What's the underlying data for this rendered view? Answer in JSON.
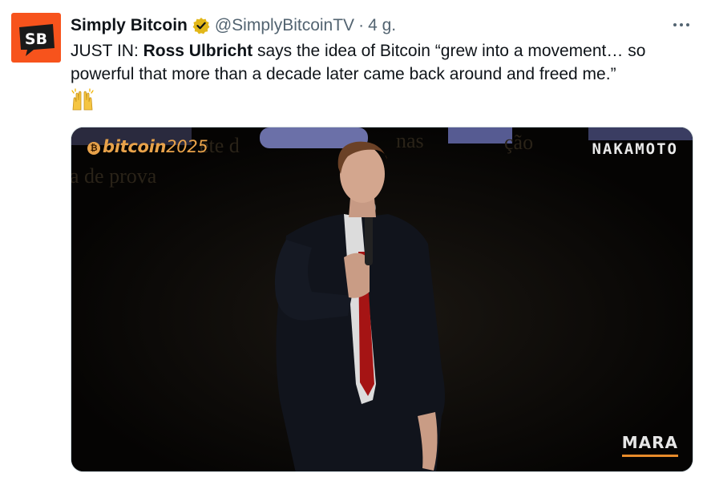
{
  "author": {
    "display_name": "Simply Bitcoin",
    "handle": "@SimplyBitcoinTV",
    "separator": "·",
    "time": "4 g.",
    "avatar_text": "SB"
  },
  "tweet": {
    "prefix": "JUST IN: ",
    "bold_name": "Ross Ulbricht",
    "body": " says the idea of Bitcoin “grew into a movement… so powerful that more than a decade later came back around and freed me.”",
    "emoji": "raising-hands-emoji"
  },
  "media": {
    "logo_left_word": "bitcoin",
    "logo_left_year": "2025",
    "logo_right": "NAKAMOTO",
    "logo_bottom_right": "MARA",
    "background_text": [
      "ete d",
      "nas",
      "ção",
      "a de prova"
    ]
  },
  "colors": {
    "avatar_bg": "#f7531c",
    "verified_badge": "#e2b719",
    "handle_gray": "#536471",
    "mara_underline": "#e88b2a"
  }
}
